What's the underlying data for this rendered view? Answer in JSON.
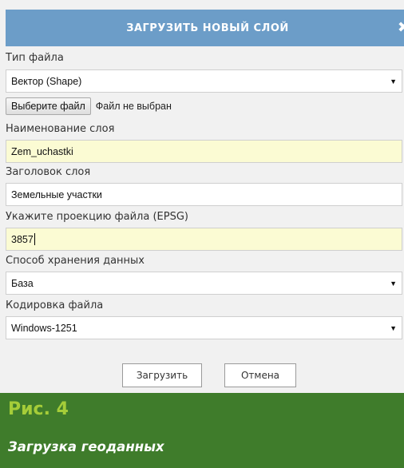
{
  "dialog": {
    "title": "ЗАГРУЗИТЬ НОВЫЙ СЛОЙ",
    "close_glyph": "✖"
  },
  "form": {
    "file_type": {
      "label": "Тип файла",
      "value": "Вектор (Shape)"
    },
    "file_picker": {
      "button_label": "Выберите файл",
      "status": "Файл не выбран"
    },
    "layer_name": {
      "label": "Наименование слоя",
      "value": "Zem_uchastki"
    },
    "layer_title": {
      "label": "Заголовок слоя",
      "value": "Земельные участки"
    },
    "projection": {
      "label": "Укажите проекцию файла (EPSG)",
      "value": "3857"
    },
    "storage": {
      "label": "Способ хранения данных",
      "value": "База"
    },
    "encoding": {
      "label": "Кодировка файла",
      "value": "Windows-1251"
    }
  },
  "buttons": {
    "upload": "Загрузить",
    "cancel": "Отмена"
  },
  "caption": {
    "number": "Рис. 4",
    "text": "Загрузка геоданных"
  },
  "colors": {
    "title_bar": "#6c9dc8",
    "dialog_bg": "#f1f1f1",
    "highlight_field": "#fbfbd3",
    "caption_bg": "#3f7c2b",
    "caption_number": "#a5cd39"
  },
  "icons": {
    "close": "close-icon",
    "select_arrow": "caret-down-icon"
  }
}
